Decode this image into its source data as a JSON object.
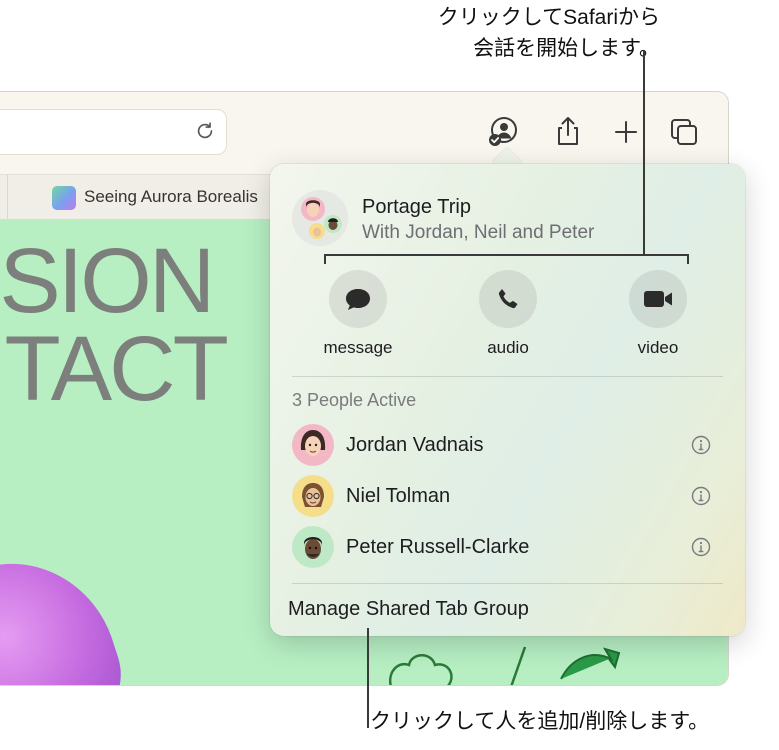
{
  "callouts": {
    "top_line1": "クリックしてSafariから",
    "top_line2": "会話を開始します。",
    "bottom": "クリックして人を追加/削除します。"
  },
  "browser": {
    "tab_title": "Seeing Aurora Borealis",
    "page_headline_line1": "SSION",
    "page_headline_line2": "NTACT"
  },
  "popover": {
    "group_title": "Portage Trip",
    "group_subtitle": "With Jordan, Neil and Peter",
    "actions": [
      {
        "label": "message",
        "icon": "message-bubble-icon"
      },
      {
        "label": "audio",
        "icon": "phone-icon"
      },
      {
        "label": "video",
        "icon": "video-camera-icon"
      }
    ],
    "people_header": "3 People Active",
    "people": [
      {
        "name": "Jordan Vadnais",
        "avatar_color": "#f2b8c6"
      },
      {
        "name": "Niel Tolman",
        "avatar_color": "#f5dd8a"
      },
      {
        "name": "Peter Russell-Clarke",
        "avatar_color": "#bfe9c6"
      }
    ],
    "manage_label": "Manage Shared Tab Group"
  },
  "colors": {
    "page_background": "#b7efc3",
    "popover_tint": "#e5f0e2"
  }
}
